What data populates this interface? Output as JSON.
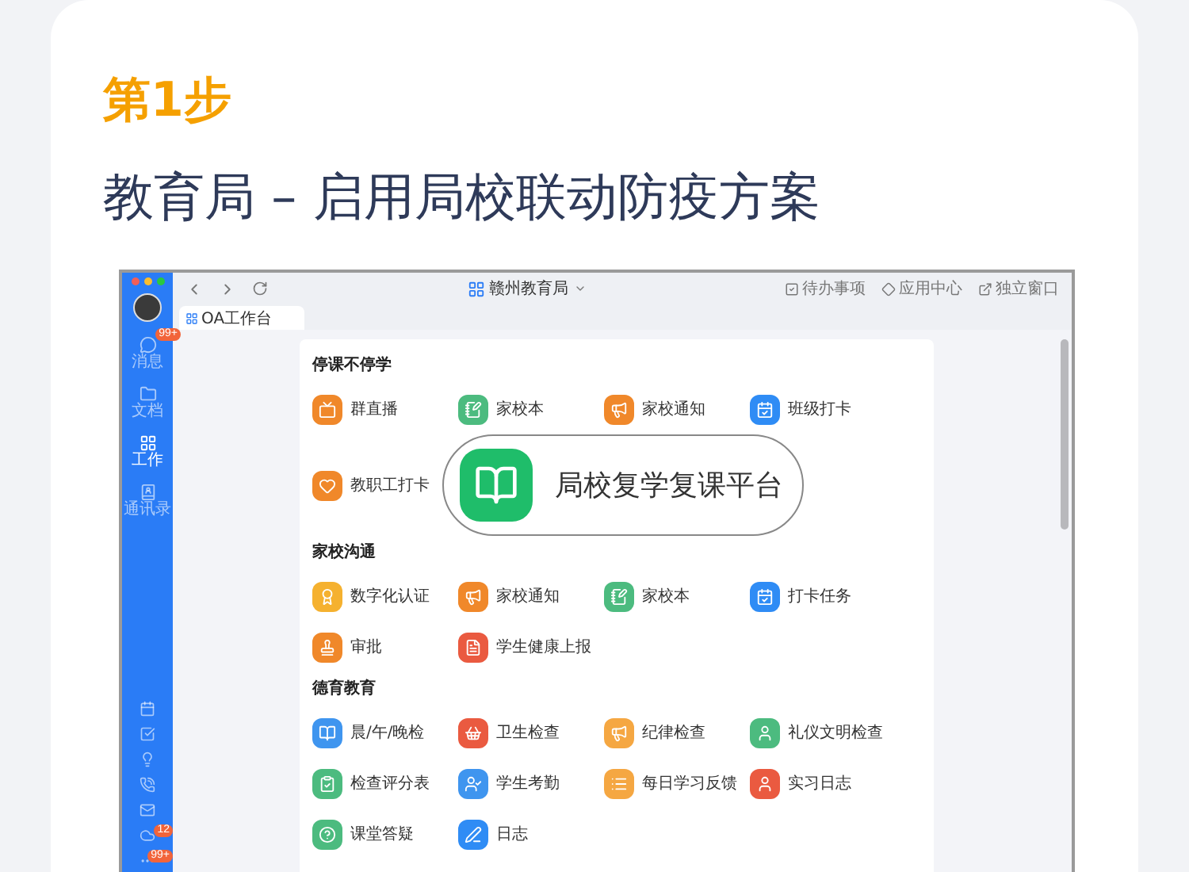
{
  "step": "第1步",
  "title": "教育局 – 启用局校联动防疫方案",
  "window": {
    "title": "赣州教育局",
    "actions": [
      {
        "kind": "todo",
        "label": "待办事项"
      },
      {
        "kind": "apps",
        "label": "应用中心"
      },
      {
        "kind": "popout",
        "label": "独立窗口"
      }
    ],
    "tabs": [
      {
        "label": "OA工作台",
        "selected": true
      }
    ],
    "sidebar": {
      "items": [
        {
          "kind": "chat",
          "label": "消息",
          "badge": "99+",
          "selected": false
        },
        {
          "kind": "docs",
          "label": "文档",
          "selected": false
        },
        {
          "kind": "work",
          "label": "工作",
          "selected": true
        },
        {
          "kind": "contacts",
          "label": "通讯录",
          "selected": false
        }
      ],
      "tools": [
        {
          "kind": "calendar"
        },
        {
          "kind": "task"
        },
        {
          "kind": "idea"
        },
        {
          "kind": "phone"
        },
        {
          "kind": "mail"
        },
        {
          "kind": "cloud",
          "badge": "12"
        },
        {
          "kind": "more",
          "badge": "99+"
        }
      ]
    },
    "sections": [
      {
        "title": "停课不停学",
        "banner": {
          "title": "局校复学复课平台"
        },
        "apps": [
          {
            "label": "群直播",
            "kind": "tv",
            "color": "#f0882a"
          },
          {
            "label": "家校本",
            "kind": "note",
            "color": "#4cbb7f"
          },
          {
            "label": "家校通知",
            "kind": "megaphone",
            "color": "#f0882a"
          },
          {
            "label": "班级打卡",
            "kind": "checkin",
            "color": "#2f8cf5"
          },
          {
            "label": "教职工打卡",
            "kind": "heart",
            "color": "#f0882a"
          }
        ]
      },
      {
        "title": "家校沟通",
        "apps": [
          {
            "label": "数字化认证",
            "kind": "medal",
            "color": "#f5b12f"
          },
          {
            "label": "家校通知",
            "kind": "megaphone",
            "color": "#f0882a"
          },
          {
            "label": "家校本",
            "kind": "note",
            "color": "#4cbb7f"
          },
          {
            "label": "打卡任务",
            "kind": "checkin",
            "color": "#2f8cf5"
          },
          {
            "label": "审批",
            "kind": "stamp",
            "color": "#f0882a"
          },
          {
            "label": "学生健康上报",
            "kind": "report",
            "color": "#ea5a40"
          }
        ]
      },
      {
        "title": "德育教育",
        "apps": [
          {
            "label": "晨/午/晚检",
            "kind": "book",
            "color": "#3f95ef"
          },
          {
            "label": "卫生检查",
            "kind": "basket",
            "color": "#ea5a40"
          },
          {
            "label": "纪律检查",
            "kind": "megaphone",
            "color": "#f5a742"
          },
          {
            "label": "礼仪文明检查",
            "kind": "person",
            "color": "#4cbb7f"
          },
          {
            "label": "检查评分表",
            "kind": "clipboard",
            "color": "#4cbb7f"
          },
          {
            "label": "学生考勤",
            "kind": "attendance",
            "color": "#3f95ef"
          },
          {
            "label": "每日学习反馈",
            "kind": "list",
            "color": "#f5a742"
          },
          {
            "label": "实习日志",
            "kind": "person",
            "color": "#ea5a40"
          },
          {
            "label": "课堂答疑",
            "kind": "question",
            "color": "#4cbb7f"
          },
          {
            "label": "日志",
            "kind": "pen",
            "color": "#2f8cf5"
          }
        ]
      }
    ]
  }
}
